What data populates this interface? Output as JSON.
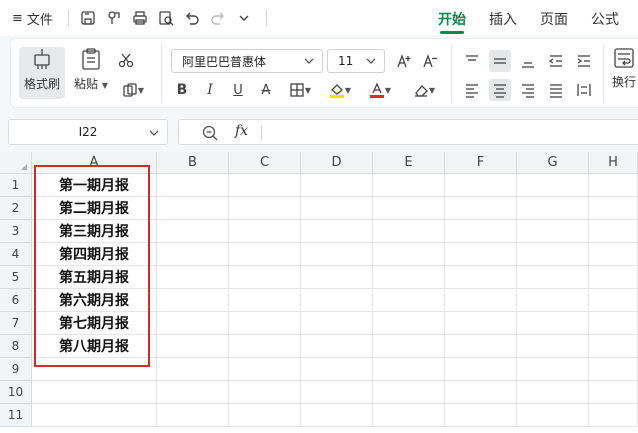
{
  "topbar": {
    "menu_label": "文件",
    "menu_icon": "≡",
    "tabs": [
      {
        "label": "开始",
        "active": true
      },
      {
        "label": "插入",
        "active": false
      },
      {
        "label": "页面",
        "active": false
      },
      {
        "label": "公式",
        "active": false
      }
    ],
    "accent_color": "#0a8a4a"
  },
  "ribbon": {
    "format_painter_label": "格式刷",
    "paste_label": "粘贴",
    "font_name": "阿里巴巴普惠体",
    "font_size": "11",
    "wrap_label": "换行",
    "font_color_bar": "#e3282a",
    "highlight_color_bar": "#f5e100"
  },
  "formula_bar": {
    "name_box": "I22",
    "fx_label": "fx",
    "formula_value": ""
  },
  "sheet": {
    "columns": [
      "A",
      "B",
      "C",
      "D",
      "E",
      "F",
      "G",
      "H"
    ],
    "rows": [
      "1",
      "2",
      "3",
      "4",
      "5",
      "6",
      "7",
      "8",
      "9",
      "10",
      "11"
    ],
    "column_a_values": [
      "第一期月报",
      "第二期月报",
      "第三期月报",
      "第四期月报",
      "第五期月报",
      "第六期月报",
      "第七期月报",
      "第八期月报"
    ],
    "highlight_color": "#d42a2a"
  }
}
